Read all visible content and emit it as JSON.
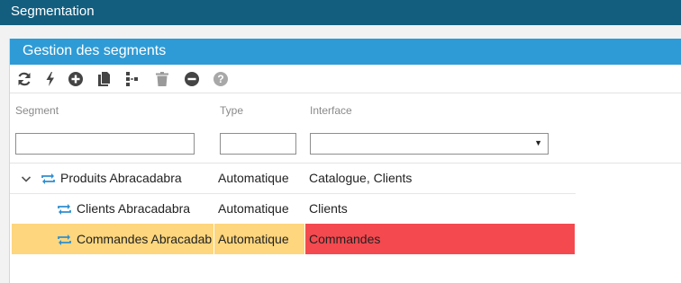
{
  "app": {
    "title": "Segmentation"
  },
  "panel": {
    "title": "Gestion des segments"
  },
  "toolbar": {
    "items": [
      {
        "name": "refresh-icon"
      },
      {
        "name": "lightning-icon"
      },
      {
        "name": "add-circle-icon"
      },
      {
        "name": "copy-icon"
      },
      {
        "name": "tree-structure-icon"
      },
      {
        "name": "trash-icon"
      },
      {
        "name": "remove-circle-icon"
      },
      {
        "name": "help-icon"
      }
    ]
  },
  "table": {
    "columns": {
      "segment": "Segment",
      "type": "Type",
      "interface": "Interface"
    },
    "filters": {
      "segment": "",
      "type": "",
      "interface": ""
    },
    "rows": [
      {
        "segment": "Produits Abracadabra",
        "type": "Automatique",
        "interface": "Catalogue, Clients",
        "expanded": true,
        "level": 0
      },
      {
        "segment": "Clients Abracadabra",
        "type": "Automatique",
        "interface": "Clients",
        "level": 1
      },
      {
        "segment": "Commandes Abracadabra",
        "type": "Automatique",
        "interface": "Commandes",
        "level": 1,
        "selected": true
      }
    ]
  },
  "colors": {
    "titlebar": "#135e7f",
    "panel_header": "#2e9bd6",
    "selected_row": "#fdd67d",
    "selected_interface": "#f4494f",
    "icon_blue": "#2e8fd0"
  }
}
